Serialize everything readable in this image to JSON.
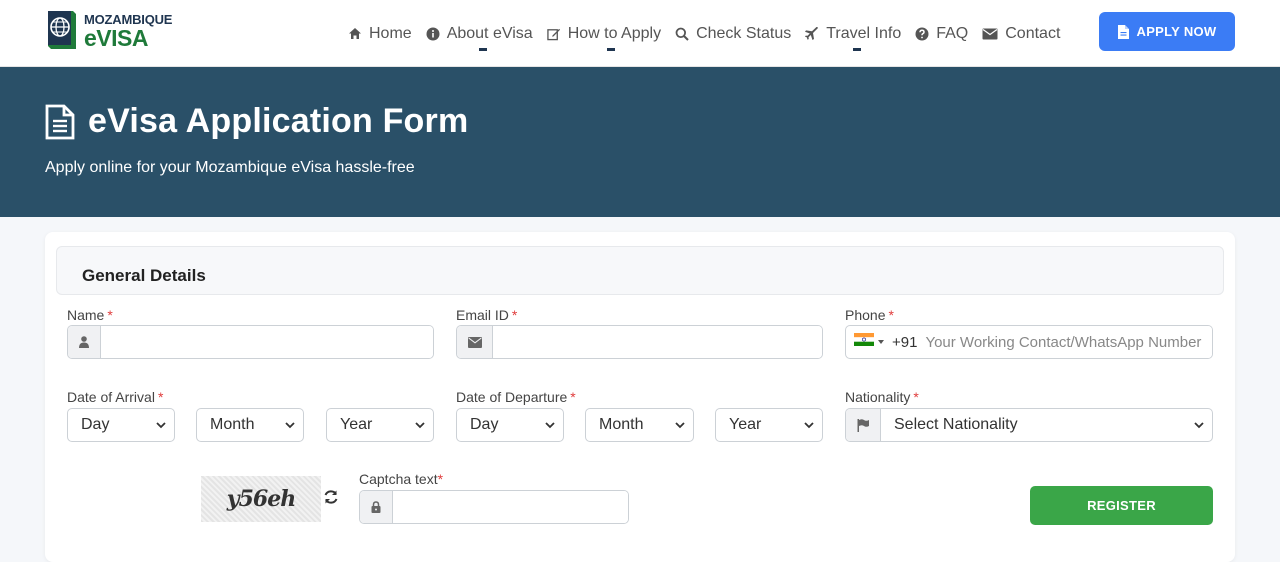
{
  "logo": {
    "top": "MOZAMBIQUE",
    "bottom": "eVISA"
  },
  "nav": {
    "items": [
      {
        "label": "Home",
        "icon": "home-icon"
      },
      {
        "label": "About eVisa",
        "icon": "info-icon"
      },
      {
        "label": "How to Apply",
        "icon": "edit-icon"
      },
      {
        "label": "Check Status",
        "icon": "search-icon"
      },
      {
        "label": "Travel Info",
        "icon": "plane-icon"
      },
      {
        "label": "FAQ",
        "icon": "question-icon"
      },
      {
        "label": "Contact",
        "icon": "envelope-icon"
      }
    ],
    "apply_label": "APPLY NOW"
  },
  "hero": {
    "title": "eVisa Application Form",
    "subtitle": "Apply online for your Mozambique eVisa hassle-free"
  },
  "form": {
    "section_title": "General Details",
    "name_label": "Name",
    "email_label": "Email ID",
    "phone_label": "Phone",
    "phone_code": "+91",
    "phone_placeholder": "Your Working Contact/WhatsApp Number",
    "arrival_label": "Date of Arrival",
    "departure_label": "Date of Departure",
    "nationality_label": "Nationality",
    "day": "Day",
    "month": "Month",
    "year": "Year",
    "nationality_value": "Select Nationality",
    "captcha_label": "Captcha text",
    "captcha_code": "y56eh",
    "register_label": "REGISTER",
    "required_mark": "*"
  },
  "colors": {
    "hero_bg": "#2a5068",
    "apply_btn": "#3b7cf5",
    "register_btn": "#3aa648",
    "required": "#e03c3c"
  }
}
